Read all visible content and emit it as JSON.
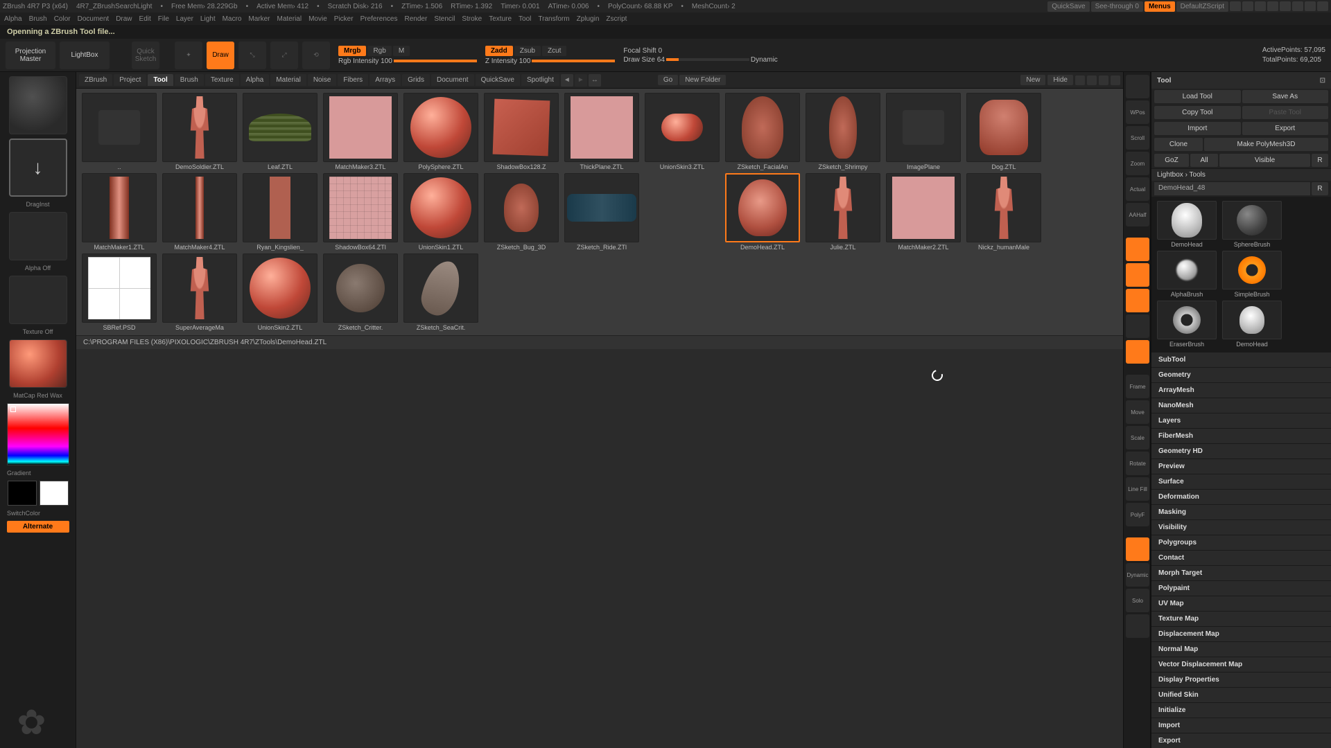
{
  "titlebar": {
    "app": "ZBrush 4R7 P3 (x64)",
    "doc": "4R7_ZBrushSearchLight",
    "stats": [
      "Free Mem› 28.229Gb",
      "Active Mem› 412",
      "Scratch Disk› 216",
      "ZTime› 1.506",
      "RTime› 1.392",
      "Timer› 0.001",
      "ATime› 0.006",
      "PolyCount› 68.88 KP",
      "MeshCount› 2"
    ],
    "quicksave": "QuickSave",
    "seethrough": "See-through  0",
    "menus": "Menus",
    "script": "DefaultZScript"
  },
  "menubar": [
    "Alpha",
    "Brush",
    "Color",
    "Document",
    "Draw",
    "Edit",
    "File",
    "Layer",
    "Light",
    "Macro",
    "Marker",
    "Material",
    "Movie",
    "Picker",
    "Preferences",
    "Render",
    "Stencil",
    "Stroke",
    "Texture",
    "Tool",
    "Transform",
    "Zplugin",
    "Zscript"
  ],
  "message": "Openning a ZBrush Tool file...",
  "shelf": {
    "projection": "Projection\nMaster",
    "lightbox": "LightBox",
    "quicksketch": "Quick\nSketch",
    "draw": "Draw",
    "mode": {
      "mrgb": "Mrgb",
      "rgb": "Rgb",
      "m": "M",
      "rgb_intensity": "Rgb Intensity 100",
      "zadd": "Zadd",
      "zsub": "Zsub",
      "zcut": "Zcut",
      "z_intensity": "Z Intensity 100"
    },
    "focal": "Focal Shift 0",
    "drawsize": "Draw Size 64",
    "dynamic": "Dynamic",
    "active": "ActivePoints: 57,095",
    "total": "TotalPoints: 69,205"
  },
  "left": {
    "draginst": "DragInst",
    "alphaoff": "Alpha  Off",
    "textureoff": "Texture  Off",
    "matcap": "MatCap  Red  Wax",
    "gradient": "Gradient",
    "switchcolor": "SwitchColor",
    "alternate": "Alternate"
  },
  "lightbox": {
    "tabs": [
      "ZBrush",
      "Project",
      "Tool",
      "Brush",
      "Texture",
      "Alpha",
      "Material",
      "Noise",
      "Fibers",
      "Arrays",
      "Grids",
      "Document",
      "QuickSave",
      "Spotlight"
    ],
    "active_tab": 2,
    "go": "Go",
    "newfolder": "New Folder",
    "new": "New",
    "hide": "Hide",
    "path": "C:\\PROGRAM FILES (X86)\\PIXOLOGIC\\ZBRUSH 4R7\\ZTools\\DemoHead.ZTL",
    "row1": [
      "..",
      "DemoSoldier.ZTL",
      "Leaf.ZTL",
      "MatchMaker3.ZTL",
      "PolySphere.ZTL",
      "ShadowBox128.Z",
      "ThickPlane.ZTL",
      "UnionSkin3.ZTL",
      "ZSketch_FacialAn",
      "ZSketch_Shrimpy"
    ],
    "row2": [
      "ImagePlane",
      "Dog.ZTL",
      "MatchMaker1.ZTL",
      "MatchMaker4.ZTL",
      "Ryan_Kingslien_",
      "ShadowBox64.ZTl",
      "UnionSkin1.ZTL",
      "ZSketch_Bug_3D",
      "ZSketch_Ride.ZTl"
    ],
    "row3": [
      "DemoHead.ZTL",
      "Julie.ZTL",
      "MatchMaker2.ZTL",
      "Nickz_humanMale",
      "SBRef.PSD",
      "SuperAverageMa",
      "UnionSkin2.ZTL",
      "ZSketch_Critter.",
      "ZSketch_SeaCrit."
    ]
  },
  "rdock": [
    "",
    "WPos",
    "Scroll",
    "Zoom",
    "Actual",
    "AAHalf",
    "",
    "",
    "",
    "",
    "",
    "",
    "",
    "Frame",
    "Move",
    "Scale",
    "Rotate",
    "Line Fill",
    "PolyF",
    "",
    "Dynamic",
    "Solo",
    ""
  ],
  "tool": {
    "title": "Tool",
    "load": "Load Tool",
    "save": "Save As",
    "copy": "Copy Tool",
    "paste": "Paste Tool",
    "import": "Import",
    "export": "Export",
    "clone": "Clone",
    "make": "Make PolyMesh3D",
    "goz": "GoZ",
    "all": "All",
    "visible": "Visible",
    "r": "R",
    "lbtools": "Lightbox › Tools",
    "toolname": "DemoHead_48",
    "brushes": [
      "DemoHead",
      "SphereBrush",
      "AlphaBrush",
      "SimpleBrush",
      "EraserBrush",
      "DemoHead"
    ],
    "accordion": [
      "SubTool",
      "Geometry",
      "ArrayMesh",
      "NanoMesh",
      "Layers",
      "FiberMesh",
      "Geometry HD",
      "Preview",
      "Surface",
      "Deformation",
      "Masking",
      "Visibility",
      "Polygroups",
      "Contact",
      "Morph Target",
      "Polypaint",
      "UV Map",
      "Texture Map",
      "Displacement Map",
      "Normal Map",
      "Vector Displacement Map",
      "Display Properties",
      "Unified Skin",
      "Initialize",
      "Import",
      "Export"
    ]
  }
}
